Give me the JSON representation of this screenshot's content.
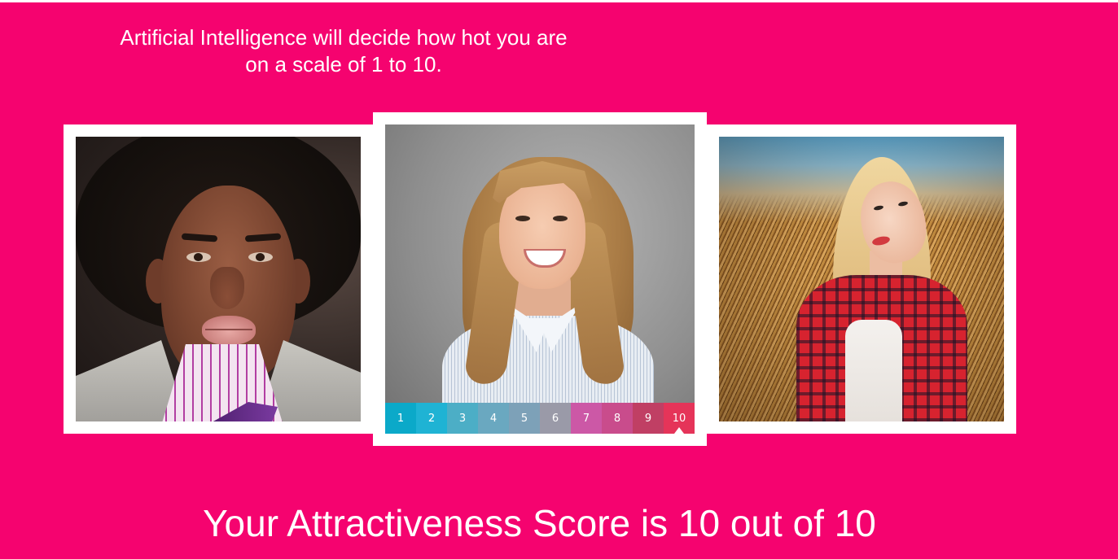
{
  "header": {
    "line1": "Artificial Intelligence will decide how hot you are",
    "line2": "on a scale of 1 to 10."
  },
  "colors": {
    "background": "#f5036f",
    "card_border": "#ffffff",
    "text": "#ffffff"
  },
  "cards": [
    {
      "label": "left-photo",
      "subject": "man-with-afro"
    },
    {
      "label": "center-photo",
      "subject": "blonde-woman-grey-backdrop"
    },
    {
      "label": "right-photo",
      "subject": "blonde-woman-hay-bales"
    }
  ],
  "score_scale": {
    "options": [
      {
        "label": "1",
        "color": "#0ba9c9"
      },
      {
        "label": "2",
        "color": "#1fb3d4"
      },
      {
        "label": "3",
        "color": "#4caec6"
      },
      {
        "label": "4",
        "color": "#6aa8c0"
      },
      {
        "label": "5",
        "color": "#7da1b8"
      },
      {
        "label": "6",
        "color": "#9a9aa8"
      },
      {
        "label": "7",
        "color": "#cc58a6"
      },
      {
        "label": "8",
        "color": "#c94c8c"
      },
      {
        "label": "9",
        "color": "#c03f64"
      },
      {
        "label": "10",
        "color": "#e53459"
      }
    ],
    "selected": "10"
  },
  "result": {
    "text": "Your Attractiveness Score is 10 out of 10"
  }
}
